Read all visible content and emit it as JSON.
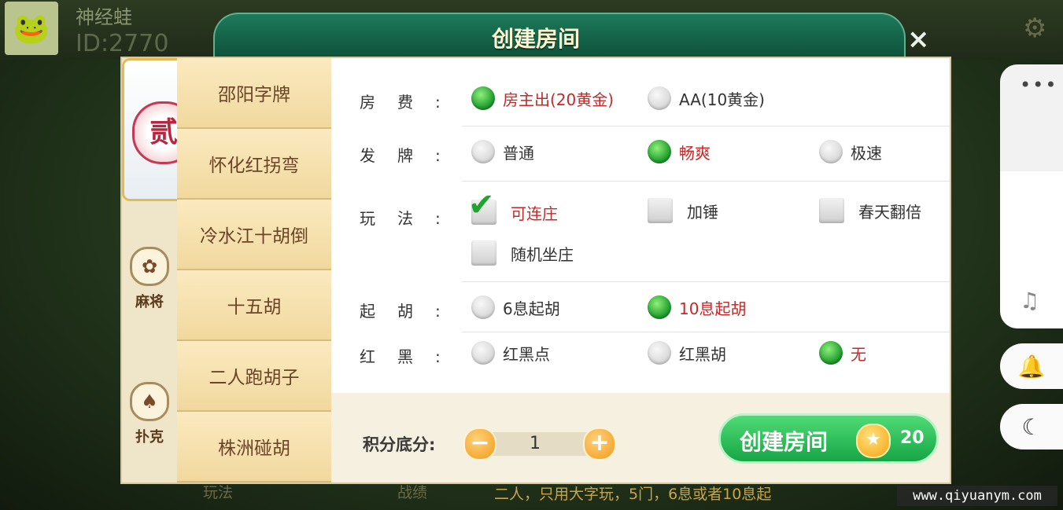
{
  "player": {
    "name": "神经蛙",
    "id": "ID:2770"
  },
  "dialog": {
    "title": "创建房间",
    "close": "×"
  },
  "categories": [
    {
      "label": "",
      "icon": "贰"
    },
    {
      "label": "麻将",
      "icon": "✿"
    },
    {
      "label": "扑克",
      "icon": "♠"
    }
  ],
  "games": [
    "邵阳字牌",
    "怀化红拐弯",
    "冷水江十胡倒",
    "十五胡",
    "二人跑胡子",
    "株洲碰胡"
  ],
  "options": {
    "room_fee": {
      "label": "房费:",
      "choices": [
        "房主出(20黄金)",
        "AA(10黄金)"
      ]
    },
    "deal": {
      "label": "发牌:",
      "choices": [
        "普通",
        "畅爽",
        "极速"
      ]
    },
    "play": {
      "label": "玩法:",
      "choices": [
        "可连庄",
        "加锤",
        "春天翻倍",
        "随机坐庄"
      ]
    },
    "min_hu": {
      "label": "起胡:",
      "choices": [
        "6息起胡",
        "10息起胡"
      ]
    },
    "red_black": {
      "label": "红黑:",
      "choices": [
        "红黑点",
        "红黑胡",
        "无"
      ]
    }
  },
  "bottom": {
    "score_label": "积分底分:",
    "score_value": "1",
    "minus": "−",
    "plus": "+",
    "create_label": "创建房间",
    "cost": "20"
  },
  "footer": {
    "description": "二人，只用大字玩，5门，6息或者10息起",
    "hint_left": "玩法",
    "hint_mid": "战绩"
  },
  "watermark": "www.qiyuanym.com",
  "system": {
    "more": "•••",
    "music": "♫",
    "bell": "🔔",
    "moon": "☾"
  }
}
